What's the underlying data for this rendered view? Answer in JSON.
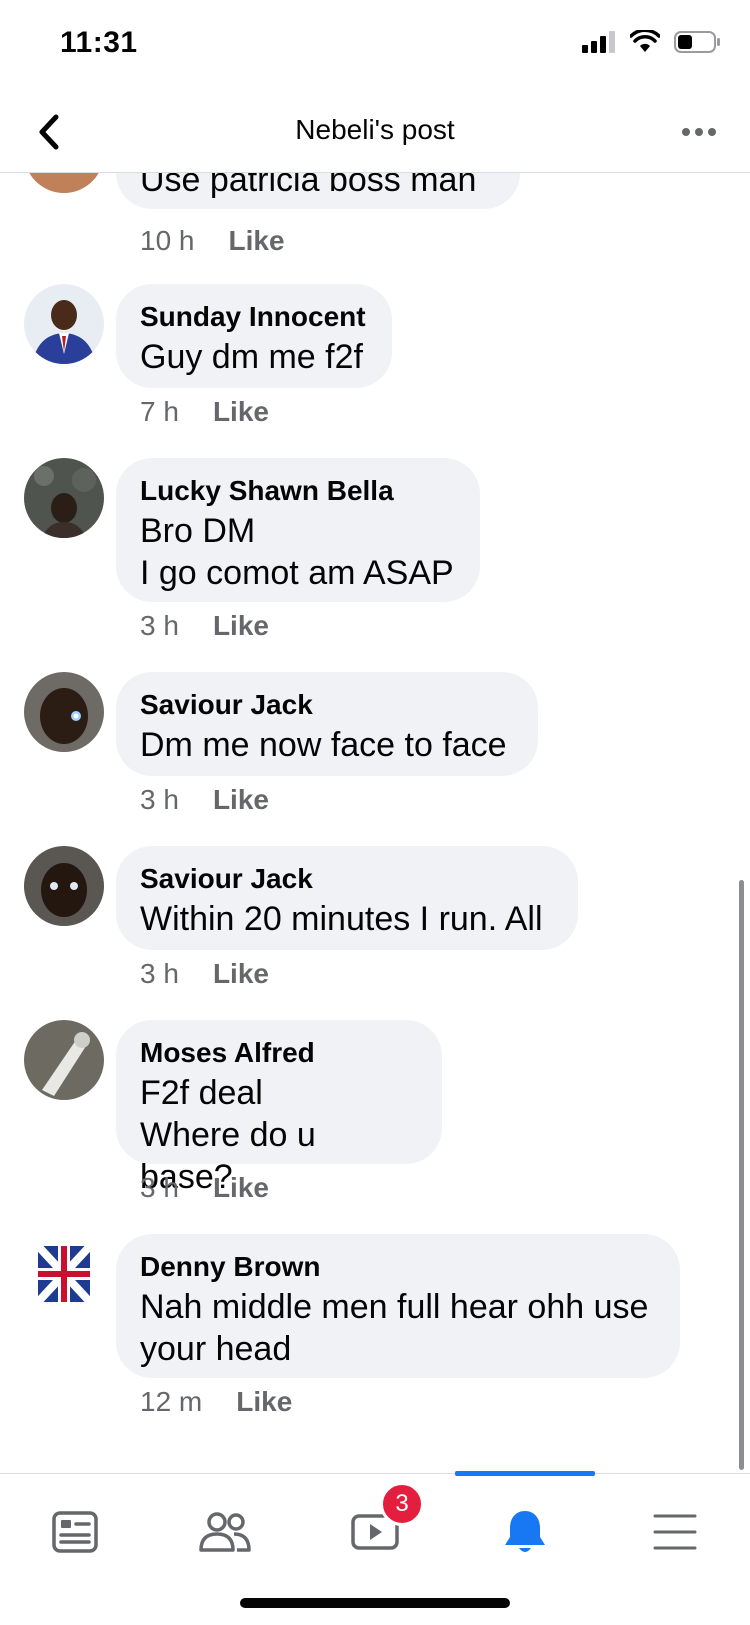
{
  "status": {
    "time": "11:31"
  },
  "header": {
    "title": "Nebeli's post"
  },
  "partial_comment": {
    "text": "Use patricia boss man",
    "time": "10 h",
    "like": "Like"
  },
  "comments": [
    {
      "name": "Sunday Innocent",
      "text": "Guy dm me f2f",
      "time": "7 h",
      "like": "Like"
    },
    {
      "name": "Lucky Shawn Bella",
      "text": "Bro DM\nI go comot am ASAP",
      "time": "3 h",
      "like": "Like"
    },
    {
      "name": "Saviour Jack",
      "text": "Dm me now face to face",
      "time": "3 h",
      "like": "Like"
    },
    {
      "name": "Saviour Jack",
      "text": "Within 20 minutes I run. All",
      "time": "3 h",
      "like": "Like"
    },
    {
      "name": "Moses Alfred",
      "text": "F2f deal\nWhere do u base?",
      "time": "3 h",
      "like": "Like"
    },
    {
      "name": "Denny Brown",
      "text": "Nah middle men full hear ohh use\nyour head",
      "time": "12 m",
      "like": "Like"
    }
  ],
  "tabbar": {
    "tabs": [
      "news-feed",
      "friends",
      "watch",
      "notifications",
      "menu"
    ],
    "active": "notifications",
    "watch_badge": "3"
  },
  "colors": {
    "accent": "#1877f2",
    "badge": "#e41e3f",
    "bubble": "#f0f2f5",
    "meta": "#65676b"
  }
}
